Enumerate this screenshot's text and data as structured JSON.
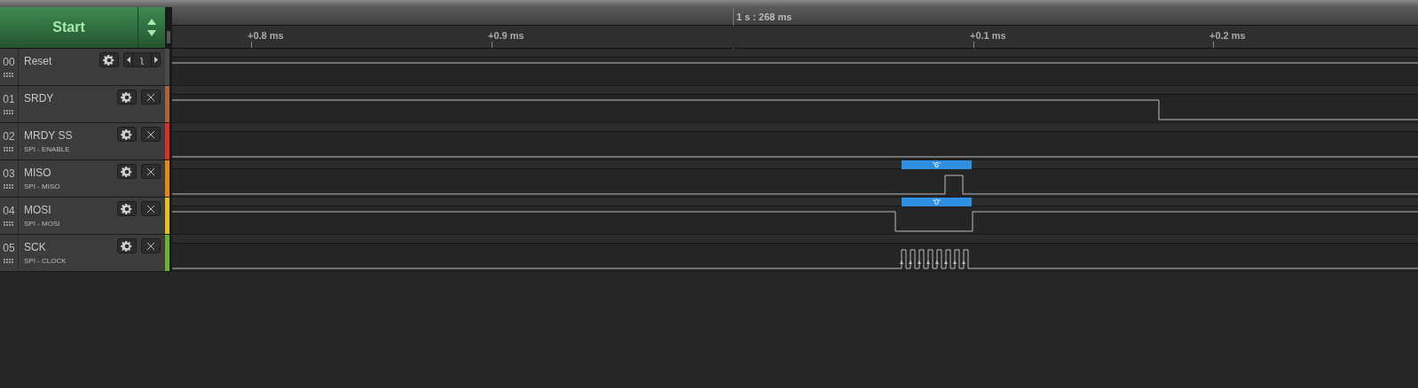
{
  "start_button": {
    "label": "Start"
  },
  "timeline": {
    "marker": "1 s : 268 ms",
    "ticks": [
      "+0.8 ms",
      "+0.9 ms",
      "+0.1 ms",
      "+0.2 ms"
    ]
  },
  "channels": [
    {
      "number": "00",
      "name": "Reset",
      "color": "#4a4a4a",
      "kind": "trigger",
      "trigger_symbol": "ʅ"
    },
    {
      "number": "01",
      "name": "SRDY",
      "color": "#a8643a",
      "kind": "close"
    },
    {
      "number": "02",
      "name": "MRDY SS",
      "analyzer": "SPI - ENABLE",
      "color": "#d7322a",
      "kind": "close"
    },
    {
      "number": "03",
      "name": "MISO",
      "analyzer": "SPI - MISO",
      "color": "#e08a1e",
      "kind": "close",
      "decoded": [
        "'6'"
      ]
    },
    {
      "number": "04",
      "name": "MOSI",
      "analyzer": "SPI - MOSI",
      "color": "#e3c02a",
      "kind": "close",
      "decoded": [
        "'0'"
      ]
    },
    {
      "number": "05",
      "name": "SCK",
      "analyzer": "SPI - CLOCK",
      "color": "#6ab13a",
      "kind": "close"
    }
  ]
}
